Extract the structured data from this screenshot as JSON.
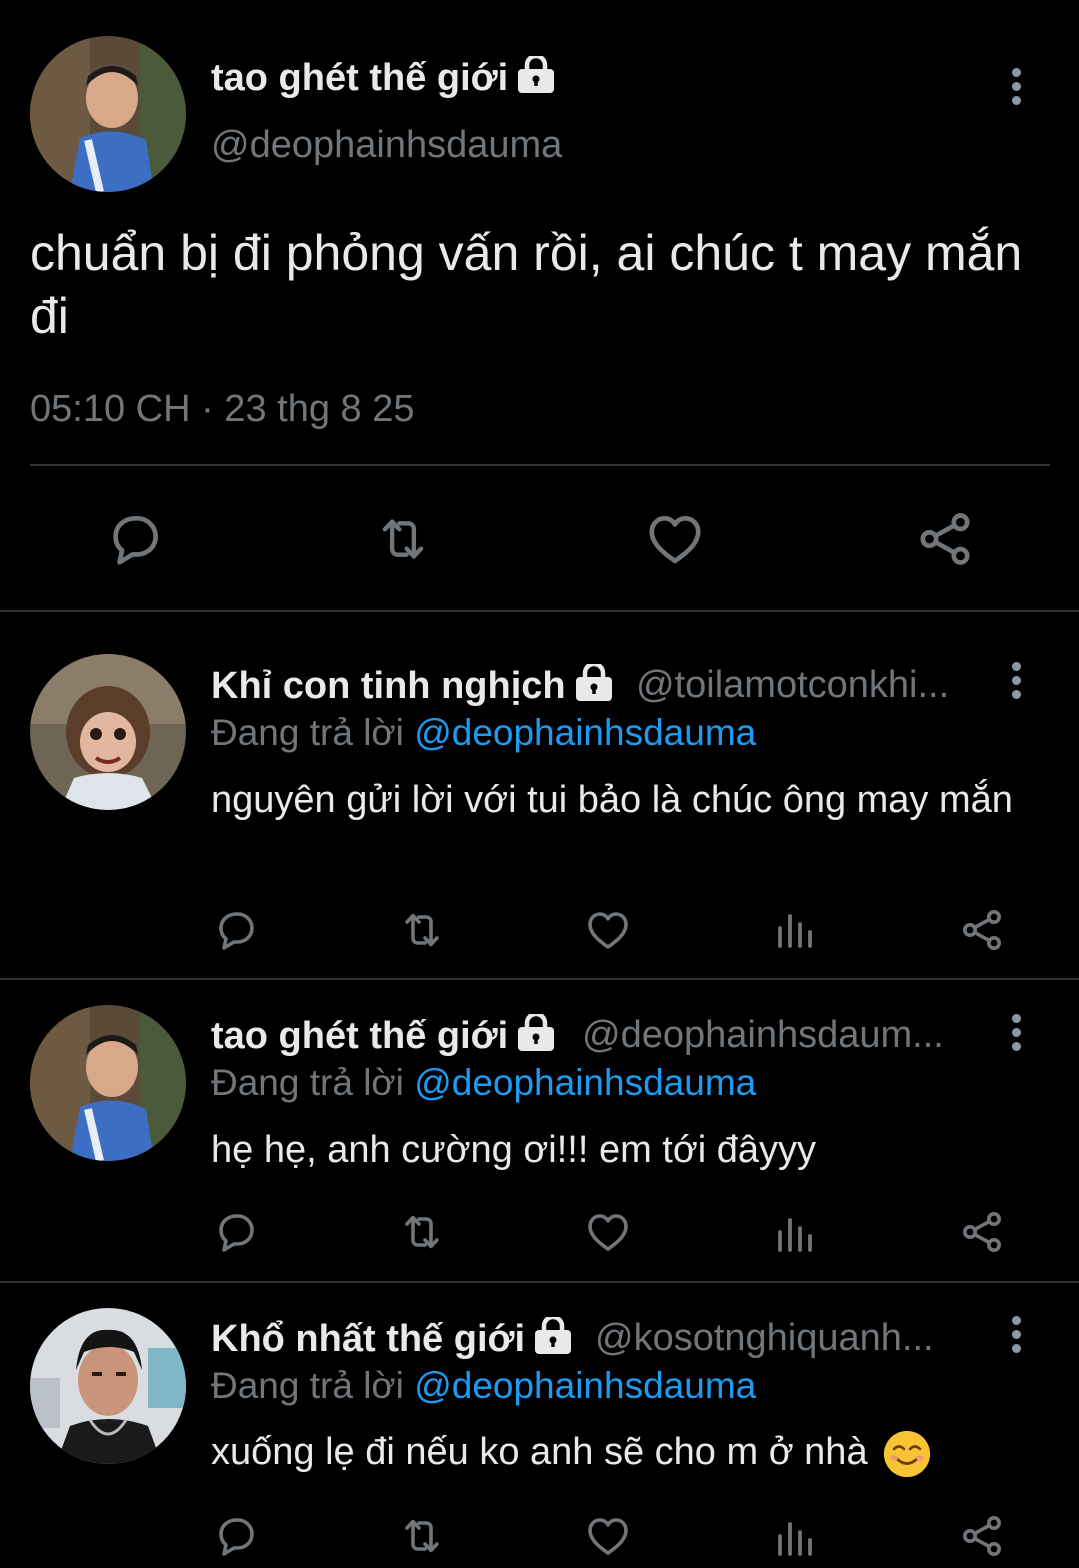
{
  "main_tweet": {
    "name": "tao ghét thế giới",
    "handle": "@deophainhsdauma",
    "text": "chuẩn bị đi phỏng vấn rồi, ai chúc t may mắn đi",
    "timestamp": "05:10 CH · 23 thg 8 25"
  },
  "replies": [
    {
      "name": "Khỉ con tinh nghịch",
      "handle": "@toilamotconkhi...",
      "reply_prefix": "Đang trả lời ",
      "reply_to": "@deophainhsdauma",
      "text": "nguyên gửi lời với tui bảo là chúc ông may mắn"
    },
    {
      "name": "tao ghét thế giới",
      "handle": "@deophainhsdaum...",
      "reply_prefix": "Đang trả lời ",
      "reply_to": "@deophainhsdauma",
      "text": "hẹ hẹ, anh cường ơi!!! em tới đâyyy"
    },
    {
      "name": "Khổ nhất thế giới",
      "handle": "@kosotnghiquanh...",
      "reply_prefix": "Đang trả lời ",
      "reply_to": "@deophainhsdauma",
      "text": "xuống lẹ đi nếu ko anh sẽ cho m ở nhà",
      "emoji": "smiling-face-emoji"
    }
  ],
  "icons": [
    "reply-icon",
    "retweet-icon",
    "like-icon",
    "views-icon",
    "share-icon",
    "lock-icon",
    "more-icon"
  ],
  "colors": {
    "background": "#000000",
    "text": "#e7e9ea",
    "muted": "#71767b",
    "mention": "#1d9bf0"
  }
}
